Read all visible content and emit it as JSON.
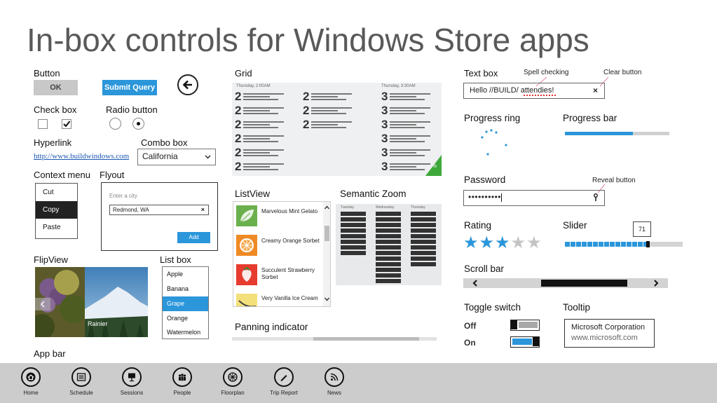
{
  "title": "In-box controls for Windows Store apps",
  "sections": {
    "button": "Button",
    "checkbox": "Check box",
    "radio": "Radio button",
    "hyperlink": "Hyperlink",
    "combobox": "Combo box",
    "context_menu": "Context menu",
    "flyout": "Flyout",
    "flipview": "FlipView",
    "listbox": "List box",
    "app_bar": "App bar",
    "grid": "Grid",
    "listview": "ListView",
    "semantic_zoom": "Semantic Zoom",
    "panning": "Panning indicator",
    "textbox": "Text box",
    "progress_ring": "Progress ring",
    "progress_bar": "Progress bar",
    "password": "Password",
    "rating": "Rating",
    "slider": "Slider",
    "scrollbar": "Scroll bar",
    "toggle": "Toggle switch",
    "tooltip": "Tooltip"
  },
  "buttons": {
    "ok": "OK",
    "submit": "Submit Query"
  },
  "hyperlink_text": "http://www.buildwindows.com",
  "combo_value": "California",
  "context_menu_items": [
    "Cut",
    "Copy",
    "Paste"
  ],
  "flyout": {
    "placeholder": "Enter a city",
    "value": "Redmond, WA",
    "add": "Add"
  },
  "flipview_caption": "Rainier",
  "listbox_items": [
    "Apple",
    "Banana",
    "Grape",
    "Orange",
    "Watermelon"
  ],
  "grid": {
    "col1_header": "Thursday, 2:00AM",
    "col3_header": "Thursday, 3:30AM",
    "col1_num": "2",
    "col2_num": "2",
    "col3_num": "3",
    "tile_label": "/b"
  },
  "listview_items": [
    "Marvelous Mint Gelato",
    "Creamy Orange Sorbet",
    "Succulent Strawberry Sorbet",
    "Very Vanilla Ice Cream"
  ],
  "semantic_zoom_days": [
    "Tuesday",
    "Wednesday",
    "Thursday"
  ],
  "textbox": {
    "value": "Hello //BUILD/ attendies!",
    "spell_note": "Spell checking",
    "clear_note": "Clear button"
  },
  "password": {
    "value": "••••••••••",
    "reveal_note": "Reveal button"
  },
  "progress_bar_fraction": 0.65,
  "rating": {
    "value": 3,
    "max": 5
  },
  "slider": {
    "value": 71,
    "max": 100
  },
  "toggles": [
    {
      "label": "Off",
      "on": false
    },
    {
      "label": "On",
      "on": true
    }
  ],
  "tooltip": {
    "line1": "Microsoft Corporation",
    "line2": "www.microsoft.com"
  },
  "app_bar_items": [
    {
      "label": "Home",
      "icon": "home-icon"
    },
    {
      "label": "Schedule",
      "icon": "schedule-icon"
    },
    {
      "label": "Sessions",
      "icon": "sessions-icon"
    },
    {
      "label": "People",
      "icon": "people-icon"
    },
    {
      "label": "Floorplan",
      "icon": "floorplan-icon"
    },
    {
      "label": "Trip Report",
      "icon": "trip-report-icon"
    },
    {
      "label": "News",
      "icon": "news-icon"
    }
  ],
  "colors": {
    "accent": "#2b96da",
    "appbar": "#cccccc",
    "title": "#595959"
  }
}
